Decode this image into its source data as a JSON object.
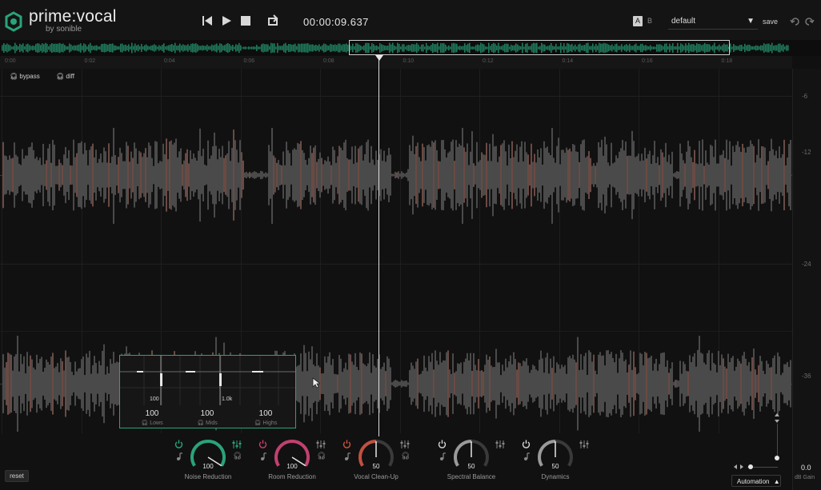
{
  "app": {
    "brand": "prime:vocal",
    "brand_sub": "by sonible",
    "accent": "#2aa37a"
  },
  "transport": {
    "time": "00:00:09.637",
    "buttons": [
      "skip-to-start-icon",
      "play-icon",
      "stop-icon",
      "loop-icon"
    ]
  },
  "header": {
    "ab_a": "A",
    "ab_b": "B",
    "preset": "default",
    "save": "save"
  },
  "ruler": {
    "ticks": [
      "0:00",
      "0:02",
      "0:04",
      "0:06",
      "0:08",
      "0:10",
      "0:12",
      "0:14",
      "0:16",
      "0:18"
    ]
  },
  "monitor": {
    "bypass": "bypass",
    "diff": "diff"
  },
  "db_scale": [
    "-6",
    "-12",
    "-24",
    "-36"
  ],
  "eq": {
    "freq_low": "100",
    "freq_high": "1.0k",
    "bands": [
      {
        "value": "100",
        "name": "Lows"
      },
      {
        "value": "100",
        "name": "Mids"
      },
      {
        "value": "100",
        "name": "Highs"
      }
    ]
  },
  "modules": [
    {
      "name": "Noise Reduction",
      "value": "100",
      "level": 1.0,
      "color": "#2aa37a"
    },
    {
      "name": "Room Reduction",
      "value": "100",
      "level": 1.0,
      "color": "#c2406f"
    },
    {
      "name": "Vocal Clean-Up",
      "value": "50",
      "level": 0.5,
      "color": "#c2503f"
    },
    {
      "name": "Spectral Balance",
      "value": "50",
      "level": 0.5,
      "color": "#9a9a9a"
    },
    {
      "name": "Dynamics",
      "value": "50",
      "level": 0.5,
      "color": "#9a9a9a"
    }
  ],
  "footer": {
    "reset": "reset",
    "automation": "Automation",
    "gain_value": "0.0",
    "gain_label": "dB Gain"
  }
}
